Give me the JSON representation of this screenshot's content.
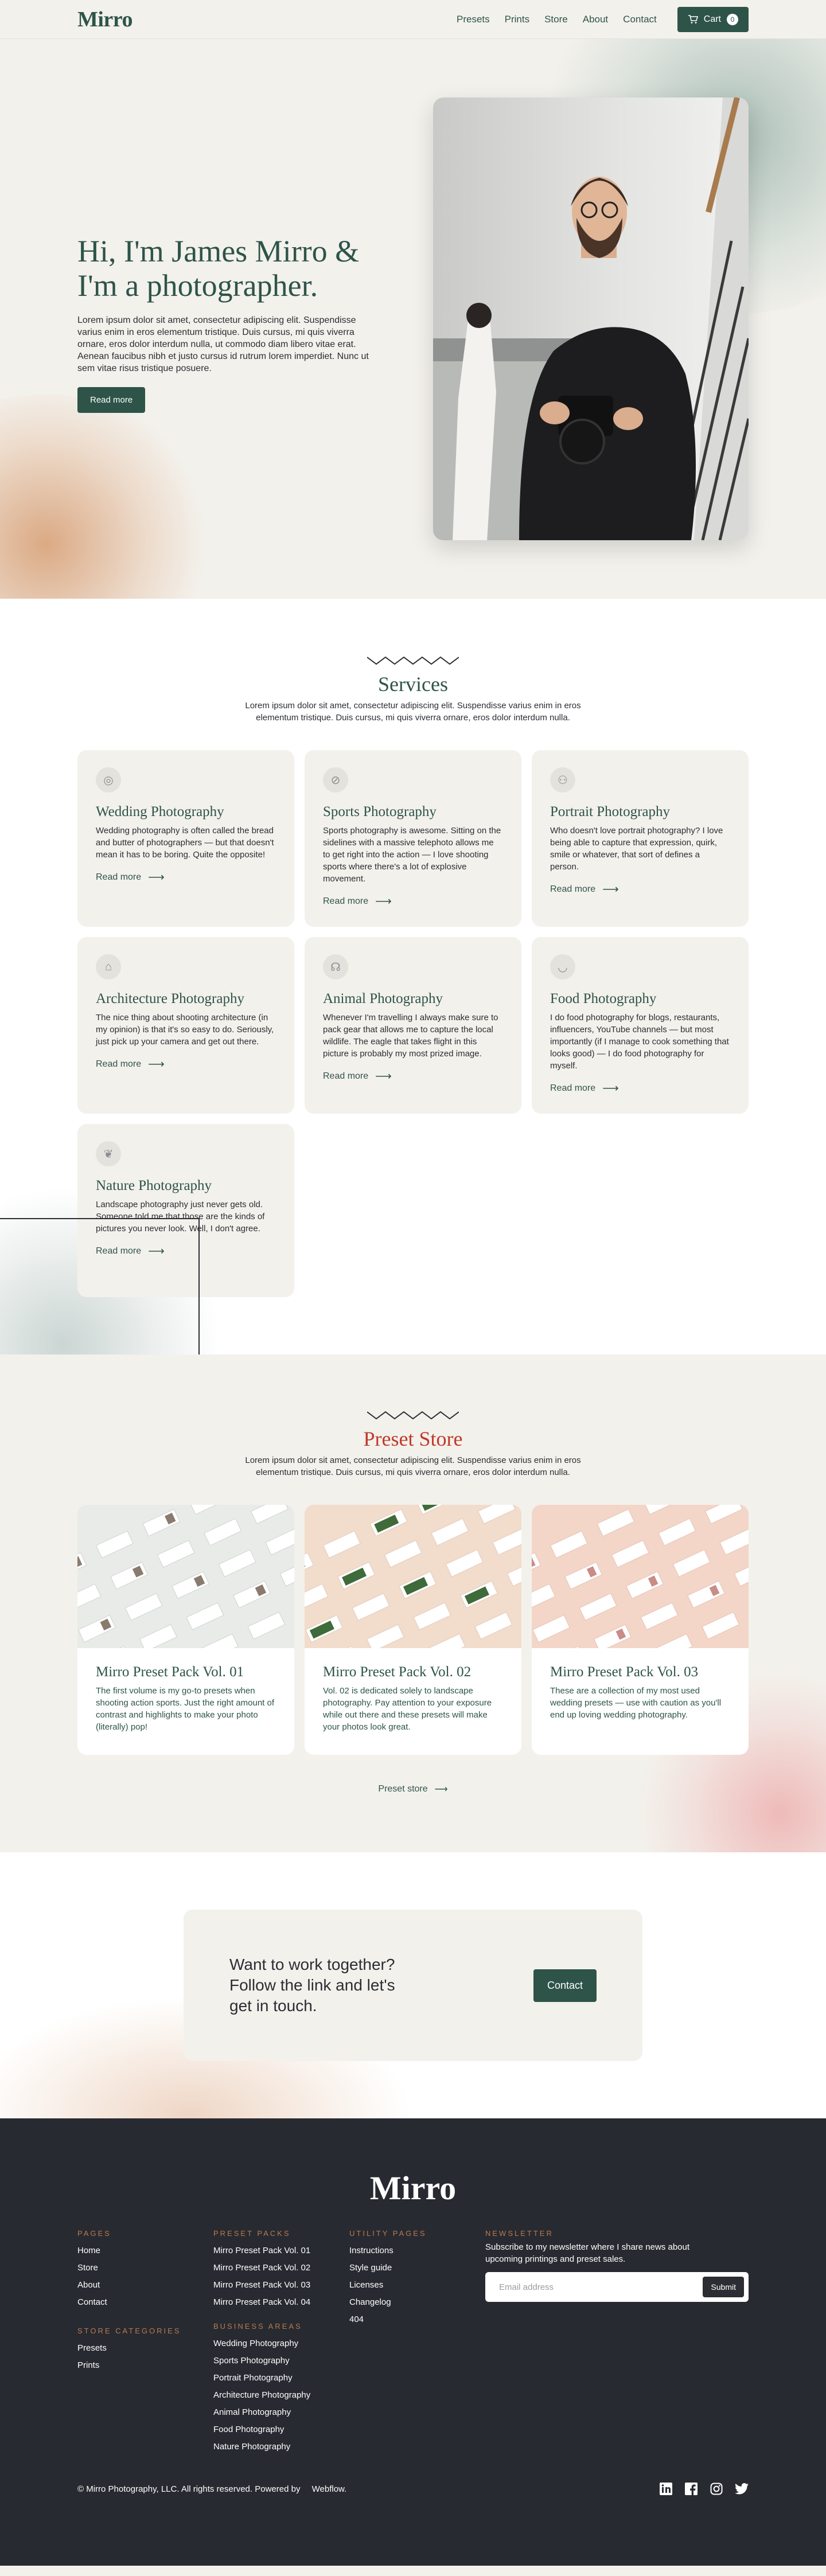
{
  "nav": {
    "logo": "Mirro",
    "links": [
      "Presets",
      "Prints",
      "Store",
      "About",
      "Contact"
    ],
    "cart_label": "Cart",
    "cart_count": "0"
  },
  "hero": {
    "title": "Hi, I'm James Mirro & I'm a photographer.",
    "description": "Lorem ipsum dolor sit amet, consectetur adipiscing elit. Suspendisse varius enim in eros elementum tristique. Duis cursus, mi quis viverra ornare, eros dolor interdum nulla, ut commodo diam libero vitae erat. Aenean faucibus nibh et justo cursus id rutrum lorem imperdiet. Nunc ut sem vitae risus tristique posuere.",
    "button": "Read more"
  },
  "services": {
    "title": "Services",
    "subtitle": "Lorem ipsum dolor sit amet, consectetur adipiscing elit. Suspendisse varius enim in eros elementum tristique. Duis cursus, mi quis viverra ornare, eros dolor interdum nulla.",
    "read_more": "Read more",
    "items": [
      {
        "icon": "ring-icon",
        "title": "Wedding Photography",
        "text": "Wedding photography is often called the bread and butter of photographers — but that doesn't mean it has to be boring. Quite the opposite!"
      },
      {
        "icon": "ball-icon",
        "title": "Sports Photography",
        "text": "Sports photography is awesome. Sitting on the sidelines with a massive telephoto allows me to get right into the action — I love shooting sports where there's a lot of explosive movement."
      },
      {
        "icon": "people-icon",
        "title": "Portrait Photography",
        "text": "Who doesn't love portrait photography? I love being able to capture that expression, quirk, smile or whatever, that sort of defines a person."
      },
      {
        "icon": "building-icon",
        "title": "Architecture Photography",
        "text": "The nice thing about shooting architecture (in my opinion) is that it's so easy to do. Seriously, just pick up your camera and get out there."
      },
      {
        "icon": "bird-icon",
        "title": "Animal Photography",
        "text": "Whenever I'm travelling I always make sure to pack gear that allows me to capture the local wildlife. The eagle that takes flight in this picture is probably my most prized image."
      },
      {
        "icon": "bowl-icon",
        "title": "Food Photography",
        "text": "I do food photography for blogs, restaurants, influencers, YouTube channels — but most importantly (if I manage to cook something that looks good) — I do food photography for myself."
      },
      {
        "icon": "leaf-icon",
        "title": "Nature Photography",
        "text": "Landscape photography just never gets old. Someone told me that those are the kinds of pictures you never look. Well, I don't agree."
      }
    ]
  },
  "store": {
    "title": "Preset Store",
    "subtitle": "Lorem ipsum dolor sit amet, consectetur adipiscing elit. Suspendisse varius enim in eros elementum tristique. Duis cursus, mi quis viverra ornare, eros dolor interdum nulla.",
    "link": "Preset store",
    "products": [
      {
        "title": "Mirro Preset Pack Vol. 01",
        "text": "The first volume is my go-to presets when shooting action sports. Just the right amount of contrast and highlights to make your photo (literally) pop!",
        "bg": "#e9ebe8"
      },
      {
        "title": "Mirro Preset Pack Vol. 02",
        "text": "Vol. 02 is dedicated solely to landscape photography. Pay attention to your exposure while out there and these presets will make your photos look great.",
        "bg": "#f2dccc"
      },
      {
        "title": "Mirro Preset Pack Vol. 03",
        "text": "These are a collection of my most used wedding presets — use with caution as you'll end up loving wedding photography.",
        "bg": "#f3d6c8"
      }
    ]
  },
  "cta": {
    "text": "Want to work together? Follow the link and let's get in touch.",
    "button": "Contact"
  },
  "footer": {
    "logo": "Mirro",
    "pages_heading": "PAGES",
    "pages": [
      "Home",
      "Store",
      "About",
      "Contact"
    ],
    "store_categories_heading": "STORE CATEGORIES",
    "store_categories": [
      "Presets",
      "Prints"
    ],
    "preset_packs_heading": "PRESET PACKS",
    "preset_packs": [
      "Mirro Preset Pack Vol. 01",
      "Mirro Preset Pack Vol. 02",
      "Mirro Preset Pack Vol. 03",
      "Mirro Preset Pack Vol. 04"
    ],
    "business_areas_heading": "BUSINESS AREAS",
    "business_areas": [
      "Wedding Photography",
      "Sports Photography",
      "Portrait Photography",
      "Architecture Photography",
      "Animal Photography",
      "Food Photography",
      "Nature Photography"
    ],
    "utility_heading": "UTILITY PAGES",
    "utility": [
      "Instructions",
      "Style guide",
      "Licenses",
      "Changelog",
      "404"
    ],
    "newsletter_heading": "NEWSLETTER",
    "newsletter_text": "Subscribe to my newsletter where I share news about upcoming printings and preset sales.",
    "email_placeholder": "Email address",
    "submit": "Submit",
    "copyright": "© Mirro Photography, LLC. All rights reserved. Powered by",
    "powered_by": "Webflow",
    "socials": [
      "linkedin-icon",
      "facebook-icon",
      "instagram-icon",
      "twitter-icon"
    ]
  }
}
